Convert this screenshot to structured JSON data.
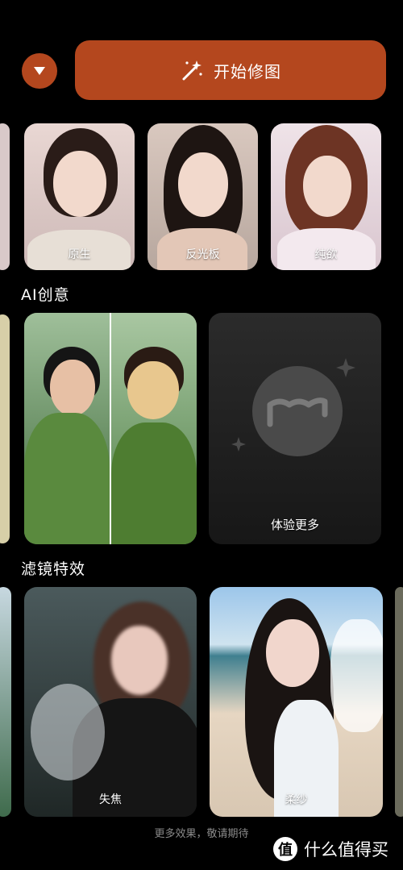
{
  "header": {
    "start_edit_label": "开始修图"
  },
  "presets": {
    "items": [
      {
        "label": "原生"
      },
      {
        "label": "反光板"
      },
      {
        "label": "纯欲"
      }
    ]
  },
  "ai_creative": {
    "title": "AI创意",
    "more_label": "体验更多"
  },
  "filters": {
    "title": "滤镜特效",
    "items": [
      {
        "label": "失焦"
      },
      {
        "label": "柔纱"
      }
    ]
  },
  "footer": {
    "text": "更多效果，敬请期待"
  },
  "watermark": {
    "logo_glyph": "值",
    "text": "什么值得买"
  },
  "colors": {
    "accent": "#b4471e",
    "background": "#000000",
    "card_dark": "#1c1c1c"
  }
}
